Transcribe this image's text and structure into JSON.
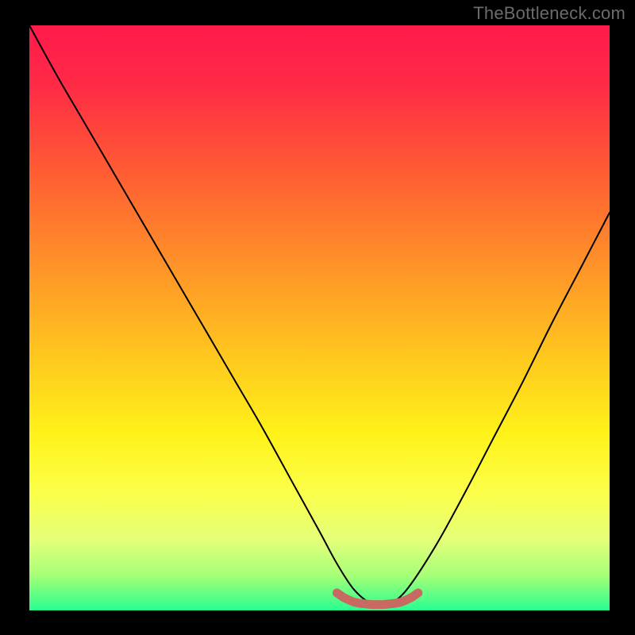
{
  "watermark": "TheBottleneck.com",
  "colors": {
    "frame": "#000000",
    "watermark": "#6b6b6b",
    "gradient_stops": [
      {
        "offset": 0.0,
        "color": "#ff1a4b"
      },
      {
        "offset": 0.1,
        "color": "#ff2a46"
      },
      {
        "offset": 0.25,
        "color": "#ff5c33"
      },
      {
        "offset": 0.4,
        "color": "#ff8f29"
      },
      {
        "offset": 0.55,
        "color": "#ffc21f"
      },
      {
        "offset": 0.7,
        "color": "#fff21a"
      },
      {
        "offset": 0.8,
        "color": "#fbff4a"
      },
      {
        "offset": 0.88,
        "color": "#e4ff7a"
      },
      {
        "offset": 0.94,
        "color": "#a6ff77"
      },
      {
        "offset": 1.0,
        "color": "#27ff8f"
      }
    ],
    "curve": "#000000",
    "marker": "#c96a62"
  },
  "chart_data": {
    "type": "line",
    "title": "",
    "xlabel": "",
    "ylabel": "",
    "xlim": [
      0,
      100
    ],
    "ylim": [
      0,
      100
    ],
    "grid": false,
    "legend": false,
    "annotations": [
      "TheBottleneck.com"
    ],
    "series": [
      {
        "name": "curve",
        "x": [
          0,
          5,
          10,
          15,
          20,
          25,
          30,
          35,
          40,
          45,
          50,
          53,
          56,
          59,
          62,
          65,
          70,
          75,
          80,
          85,
          90,
          95,
          100
        ],
        "y": [
          100,
          91,
          82.5,
          74,
          65.5,
          57,
          48.5,
          40,
          31.5,
          22.5,
          13.5,
          8,
          3.5,
          1.2,
          1.2,
          3.5,
          11,
          20,
          29.5,
          39,
          49,
          58.5,
          68
        ]
      },
      {
        "name": "flat-marker",
        "x": [
          53,
          54,
          55,
          56,
          57,
          58,
          59,
          60,
          61,
          62,
          63,
          64,
          65,
          66,
          67
        ],
        "y": [
          3.0,
          2.3,
          1.8,
          1.4,
          1.2,
          1.1,
          1.0,
          1.0,
          1.0,
          1.1,
          1.2,
          1.4,
          1.8,
          2.3,
          3.0
        ]
      }
    ]
  }
}
